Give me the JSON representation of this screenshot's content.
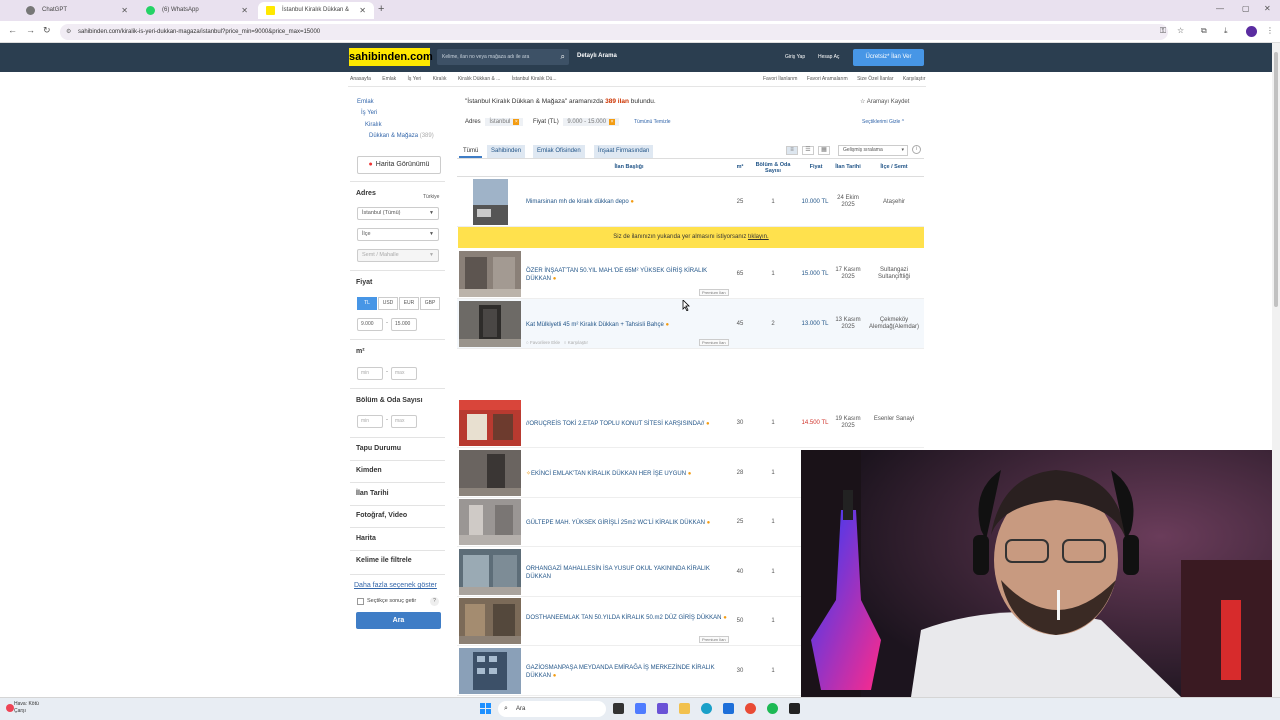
{
  "browser": {
    "tabs": [
      {
        "label": "ChatGPT"
      },
      {
        "label": "(6) WhatsApp"
      },
      {
        "label": "İstanbul Kiralık Dükkan & Mağ..."
      }
    ],
    "url": "sahibinden.com/kiralik-is-yeri-dukkan-magaza/istanbul?price_min=9000&price_max=15000"
  },
  "header": {
    "logo": "sahibinden.com",
    "search_placeholder": "Kelime, ilan no veya mağaza adı ile ara",
    "detayli_arama": "Detaylı Arama",
    "giris": "Giriş Yap",
    "hesap_ac": "Hesap Aç",
    "ilan_ver": "Ücretsiz* İlan Ver"
  },
  "breadcrumb": [
    "Anasayfa",
    "Emlak",
    "İş Yeri",
    "Kiralık",
    "Kiralık Dükkan & ...",
    "İstanbul Kiralık Dü..."
  ],
  "toplinks": [
    "Favori İlanlarım",
    "Favori Aramalarım",
    "Size Özel İlanlar",
    "Karşılaştır"
  ],
  "sidebar": {
    "categories": [
      {
        "label": "Emlak"
      },
      {
        "label": "İş Yeri"
      },
      {
        "label": "Kiralık"
      },
      {
        "label": "Dükkan & Mağaza",
        "count": "(389)"
      }
    ],
    "map_button": "Harita Görünümü",
    "adres_label": "Adres",
    "turkiye": "Türkiye",
    "il_select": "İstanbul (Tümü)",
    "ilce_select": "İlçe",
    "semt_select": "Semt / Mahalle",
    "fiyat_label": "Fiyat",
    "currencies": [
      "TL",
      "USD",
      "EUR",
      "GBP"
    ],
    "price_min": "9.000",
    "price_max": "15.000",
    "m2_label": "m²",
    "min_ph": "min",
    "max_ph": "max",
    "oda_label": "Bölüm & Oda Sayısı",
    "collapsed": [
      "Tapu Durumu",
      "Kimden",
      "İlan Tarihi",
      "Fotoğraf, Video",
      "Harita",
      "Kelime ile filtrele"
    ],
    "more_link": "Daha fazla seçenek göster",
    "secili_label": "Seçtikçe sonuç getir",
    "ara_button": "Ara"
  },
  "results": {
    "title_pre": "\"İstanbul Kiralık Dükkan & Mağaza\" aramanızda ",
    "title_count": "389 ilan",
    "title_post": " bulundu.",
    "kaydet": "Aramayı Kaydet",
    "adres_label": "Adres",
    "adres_value": "İstanbul",
    "fiyat_label": "Fiyat (TL)",
    "fiyat_value": "9.000 - 15.000",
    "temizle": "Tümünü Temizle",
    "gizle": "Seçtiklerimi Gizle",
    "tabs": [
      "Tümü",
      "Sahibinden",
      "Emlak Ofisinden",
      "İnşaat Firmasından"
    ],
    "sort": "Gelişmiş sıralama",
    "columns": [
      "İlan Başlığı",
      "m²",
      "Bölüm & Oda Sayısı",
      "Fiyat",
      "İlan Tarihi",
      "İlçe / Semt"
    ],
    "yellow_banner_text": "Siz de ilanınızın yukarıda yer almasını istiyorsanız ",
    "yellow_banner_link": "tıklayın.",
    "premium_label": "Premium İlan",
    "favori": "Favorilere Ekle",
    "karsilastir": "Karşılaştır",
    "rows": [
      {
        "title": "Mimarsinan mh de kiralık dükkan depo",
        "m2": "25",
        "oda": "1",
        "price": "10.000 TL",
        "date": "24 Ekim 2025",
        "loc": "Ataşehir"
      },
      {
        "title": "ÖZER İNŞAAT'TAN   50.YIL MAH.'DE   65M²   YÜKSEK GİRİŞ   KİRALIK DÜKKAN",
        "m2": "65",
        "oda": "1",
        "price": "15.000 TL",
        "date": "17 Kasım 2025",
        "loc": "Sultangazi Sultançiftliği"
      },
      {
        "title": "Kat Mülkiyetli 45 m² Kiralık Dükkan + Tahsisli Bahçe",
        "m2": "45",
        "oda": "2",
        "price": "13.000 TL",
        "date": "13 Kasım 2025",
        "loc": "Çekmeköy Alemdağ(Alemdar)"
      },
      {
        "title": "//ORUÇREİS TOKİ 2.ETAP TOPLU KONUT SİTESİ KARŞISINDA//",
        "m2": "30",
        "oda": "1",
        "price": "14.500 TL",
        "date": "19 Kasım 2025",
        "loc": "Esenler Sanayi"
      },
      {
        "title": "EKİNCİ EMLAK'TAN KİRALIK DÜKKAN HER İŞE UYGUN",
        "m2": "28",
        "oda": "1",
        "price": "",
        "date": "",
        "loc": ""
      },
      {
        "title": "GÜLTEPE MAH. YÜKSEK GİRİŞLİ 25m2 WC'Lİ KİRALIK DÜKKAN",
        "m2": "25",
        "oda": "1",
        "price": "",
        "date": "",
        "loc": ""
      },
      {
        "title": "ORHANGAZİ MAHALLESİN İSA YUSUF OKUL YAKININDA KİRALIK DÜKKAN",
        "m2": "40",
        "oda": "1",
        "price": "",
        "date": "",
        "loc": ""
      },
      {
        "title": "DOSTHANEEMLAK TAN 50.YILDA KİRALIK 50.m2 DÜZ GİRİŞ DÜKKAN",
        "m2": "50",
        "oda": "1",
        "price": "",
        "date": "",
        "loc": ""
      },
      {
        "title": "GAZİOSMANPAŞA MEYDANDA EMİRAĞA İŞ MERKEZİNDE KİRALIK DÜKKAN",
        "m2": "30",
        "oda": "1",
        "price": "",
        "date": "",
        "loc": ""
      }
    ]
  },
  "taskbar": {
    "weather_line1": "Hava: Kötü",
    "weather_line2": "Çarşı",
    "search": "Ara"
  },
  "colors": {
    "header_bg": "#2b3e50",
    "logo_yellow": "#ffe800",
    "accent_blue": "#4796e6",
    "price_red": "#d0342c"
  }
}
